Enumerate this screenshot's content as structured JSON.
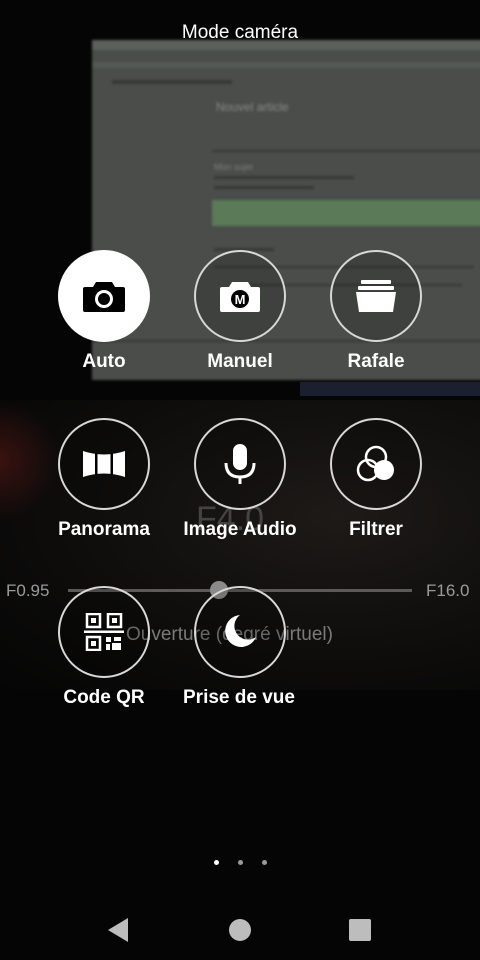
{
  "header": {
    "title": "Mode caméra"
  },
  "background": {
    "aperture_value": "F4.0",
    "aperture_min": "F0.95",
    "aperture_max": "F16.0",
    "aperture_caption": "Ouverture (degré virtuel)",
    "aperture_level": 0.44,
    "photo_heading": "Nouvel article",
    "photo_subheading": "Mon sujet"
  },
  "modes": [
    {
      "label": "Auto",
      "icon": "camera-icon",
      "active": true
    },
    {
      "label": "Manuel",
      "icon": "manual-camera-icon",
      "active": false
    },
    {
      "label": "Rafale",
      "icon": "burst-icon",
      "active": false
    },
    {
      "label": "Panorama",
      "icon": "panorama-icon",
      "active": false
    },
    {
      "label": "Image Audio",
      "icon": "microphone-icon",
      "active": false
    },
    {
      "label": "Filtrer",
      "icon": "filter-icon",
      "active": false
    },
    {
      "label": "Code QR",
      "icon": "qr-code-icon",
      "active": false
    },
    {
      "label": "Prise de vue nocturne",
      "icon": "moon-icon",
      "active": false
    }
  ],
  "pager": {
    "pages": 3,
    "current": 1
  },
  "navbar": {
    "back": "back-icon",
    "home": "home-icon",
    "recents": "recents-icon"
  },
  "colors": {
    "background": "#050505",
    "text": "#ffffff",
    "active_circle": "#ffffff"
  }
}
